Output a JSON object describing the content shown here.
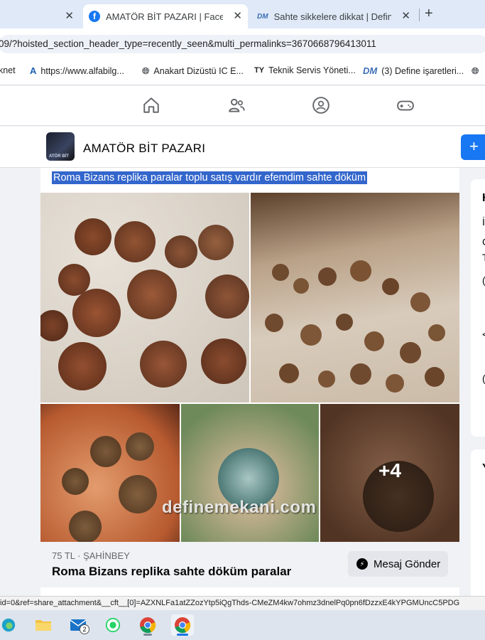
{
  "browser": {
    "tabs": [
      {
        "title": ""
      },
      {
        "title": "AMATÖR BİT PAZARI | Facebook"
      },
      {
        "title": "Sahte sikkelere dikkat | Define iş"
      }
    ],
    "address": "09/?hoisted_section_header_type=recently_seen&multi_permalinks=3670668796413011",
    "bookmarks": [
      {
        "label": "knet"
      },
      {
        "label": "https://www.alfabilg..."
      },
      {
        "label": "Anakart Dizüstü IC E..."
      },
      {
        "label": "Teknik Servis Yöneti..."
      },
      {
        "label": "(3) Define işaretleri..."
      }
    ],
    "status_url": "id=0&ref=share_attachment&__cft__[0]=AZXNLFa1atZZozYtp5iQgThds-CMeZM4kw7ohmz3dnelPq0pn6fDzzxE4kYPGMUncC5PDG"
  },
  "group": {
    "name": "AMATÖR BİT PAZARI",
    "avatar_tag": "ATÖR BİT"
  },
  "post": {
    "text": "Roma Bizans replika paralar toplu satış vardır efemdim sahte döküm",
    "more_photos": "+4",
    "watermark": "definemekani.com",
    "listing": {
      "price_location": "75 TL · ŞAHİNBEY",
      "title": "Roma Bizans replika sahte döküm paralar",
      "message_button": "Mesaj Gönder"
    }
  },
  "sidebar_fragments": {
    "card1": [
      "H",
      "İ",
      "C",
      "T",
      "(",
      "<",
      "("
    ],
    "card2": [
      "Y"
    ]
  },
  "taskbar": {
    "mail_badge": "2"
  }
}
